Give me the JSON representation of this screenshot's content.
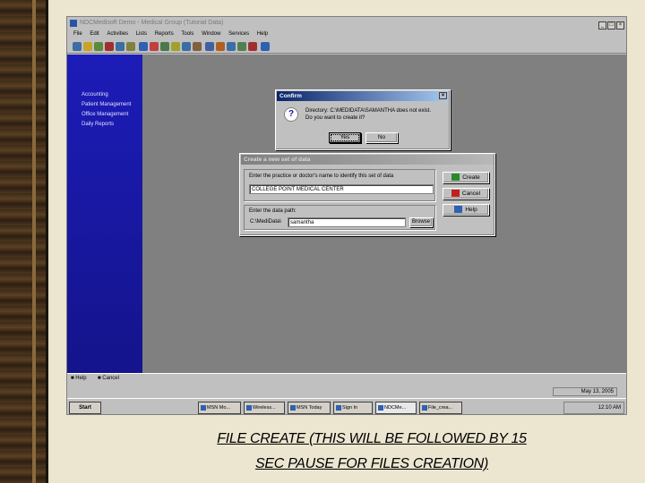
{
  "window": {
    "title": "NDCMedisoft Demo - Medical Group (Tutorial Data)",
    "controls": [
      "_",
      "□",
      "×"
    ]
  },
  "menu": [
    "File",
    "Edit",
    "Activities",
    "Lists",
    "Reports",
    "Tools",
    "Window",
    "Services",
    "Help"
  ],
  "sidebar": {
    "items": [
      "Accounting",
      "Patient Management",
      "Office Management",
      "Daily Reports"
    ]
  },
  "confirm_dialog": {
    "title": "Confirm",
    "line1": "Directory: C:\\MEDIDATA\\SAMANTHA  does not exist.",
    "line2": "Do you want to create it?",
    "yes": "Yes",
    "no": "No"
  },
  "create_dialog": {
    "title": "Create a new set of data",
    "name_label": "Enter the practice or doctor's name to identify this set of data",
    "name_value": "COLLEGE POINT MEDICAL CENTER",
    "path_label": "Enter the data path:",
    "path_prefix": "C:\\MediData\\",
    "path_value": "samantha",
    "browse": "Browse",
    "create": "Create",
    "cancel": "Cancel",
    "help": "Help"
  },
  "statusbar": {
    "help": "Help",
    "cancel": "Cancel",
    "date": "May 13, 2005"
  },
  "taskbar": {
    "start": "Start",
    "tasks": [
      "MSN Mo...",
      "Wireless...",
      "MSN Today",
      "Sign In",
      "NDCMe...",
      "File_crea..."
    ],
    "clock": "12:10 AM"
  },
  "caption": {
    "line1": "FILE CREATE (THIS WILL BE FOLLOWED BY 15",
    "line2": "SEC PAUSE FOR FILES CREATION)"
  },
  "colors": {
    "sidebar": "#1a1ab0",
    "workspace": "#808080",
    "title_active": "#0a246a"
  }
}
